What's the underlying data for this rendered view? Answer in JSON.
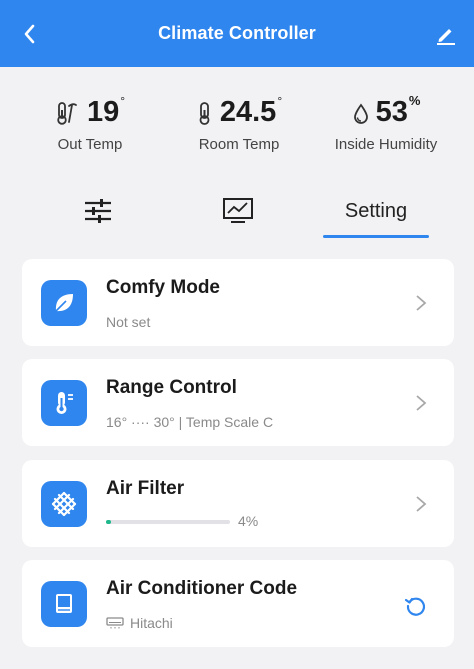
{
  "header": {
    "title": "Climate Controller"
  },
  "stats": {
    "out_temp": {
      "value": "19",
      "unit": "°",
      "label": "Out Temp"
    },
    "room_temp": {
      "value": "24.5",
      "unit": "°",
      "label": "Room Temp"
    },
    "humidity": {
      "value": "53",
      "unit": "%",
      "label": "Inside Humidity"
    }
  },
  "tabs": {
    "active": "Setting",
    "setting_label": "Setting"
  },
  "cards": {
    "comfy": {
      "title": "Comfy Mode",
      "subtitle": "Not set"
    },
    "range": {
      "title": "Range Control",
      "subtitle": "16° ···· 30° | Temp Scale C"
    },
    "filter": {
      "title": "Air Filter",
      "percent_text": "4%",
      "progress": 0.04
    },
    "ac_code": {
      "title": "Air Conditioner Code",
      "brand": "Hitachi"
    }
  },
  "colors": {
    "accent": "#2f86ee",
    "progress": "#1fb88c",
    "background": "#f2f2f4"
  },
  "icons": {
    "back": "chevron-left-icon",
    "edit": "pencil-icon",
    "out_temp": "outdoor-thermometer-icon",
    "room_temp": "thermometer-icon",
    "humidity": "water-drop-icon",
    "tab_controls": "sliders-icon",
    "tab_chart": "chart-monitor-icon",
    "comfy": "leaf-icon",
    "range": "thermometer-range-icon",
    "filter": "filter-grid-icon",
    "ac_code": "book-icon",
    "ac_unit": "air-conditioner-icon",
    "refresh": "refresh-icon",
    "chevron": "chevron-right-icon"
  }
}
